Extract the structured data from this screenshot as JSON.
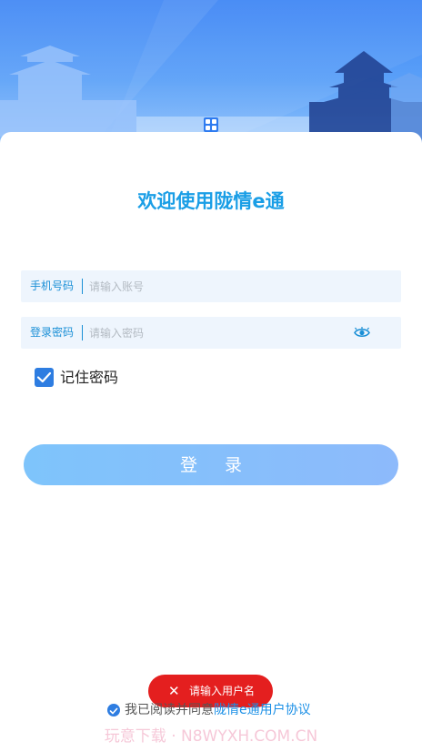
{
  "header": {
    "menu_icon": "grid-icon"
  },
  "login": {
    "title": "欢迎使用陇情e通",
    "phone": {
      "label": "手机号码",
      "placeholder": "请输入账号",
      "value": ""
    },
    "password": {
      "label": "登录密码",
      "placeholder": "请输入密码",
      "value": "",
      "toggle_icon": "eye-icon"
    },
    "remember": {
      "label": "记住密码",
      "checked": true
    },
    "submit_label": "登 录"
  },
  "toast": {
    "icon": "close-icon",
    "message": "请输入用户名"
  },
  "agreement": {
    "prefix": "我已阅读并同意",
    "link": "陇情e通用户协议",
    "checked": true
  },
  "watermark": "玩意下载 · N8WYXH.COM.CN",
  "colors": {
    "accent": "#1a9ee6",
    "field_bg": "#eef5fd",
    "button": "#8dbafb",
    "toast": "#e41f1f"
  }
}
